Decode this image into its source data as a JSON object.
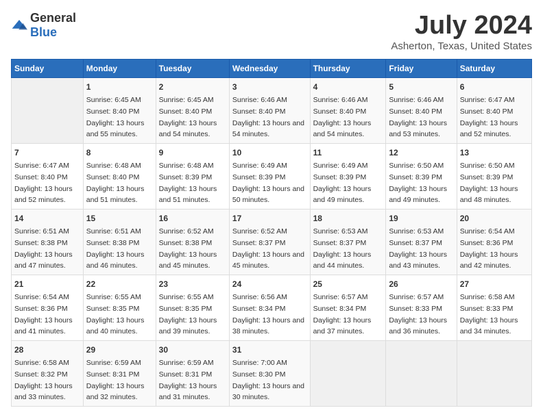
{
  "logo": {
    "general": "General",
    "blue": "Blue"
  },
  "title": {
    "month_year": "July 2024",
    "location": "Asherton, Texas, United States"
  },
  "days_of_week": [
    "Sunday",
    "Monday",
    "Tuesday",
    "Wednesday",
    "Thursday",
    "Friday",
    "Saturday"
  ],
  "weeks": [
    [
      {
        "day": "",
        "sunrise": "",
        "sunset": "",
        "daylight": ""
      },
      {
        "day": "1",
        "sunrise": "Sunrise: 6:45 AM",
        "sunset": "Sunset: 8:40 PM",
        "daylight": "Daylight: 13 hours and 55 minutes."
      },
      {
        "day": "2",
        "sunrise": "Sunrise: 6:45 AM",
        "sunset": "Sunset: 8:40 PM",
        "daylight": "Daylight: 13 hours and 54 minutes."
      },
      {
        "day": "3",
        "sunrise": "Sunrise: 6:46 AM",
        "sunset": "Sunset: 8:40 PM",
        "daylight": "Daylight: 13 hours and 54 minutes."
      },
      {
        "day": "4",
        "sunrise": "Sunrise: 6:46 AM",
        "sunset": "Sunset: 8:40 PM",
        "daylight": "Daylight: 13 hours and 54 minutes."
      },
      {
        "day": "5",
        "sunrise": "Sunrise: 6:46 AM",
        "sunset": "Sunset: 8:40 PM",
        "daylight": "Daylight: 13 hours and 53 minutes."
      },
      {
        "day": "6",
        "sunrise": "Sunrise: 6:47 AM",
        "sunset": "Sunset: 8:40 PM",
        "daylight": "Daylight: 13 hours and 52 minutes."
      }
    ],
    [
      {
        "day": "7",
        "sunrise": "Sunrise: 6:47 AM",
        "sunset": "Sunset: 8:40 PM",
        "daylight": "Daylight: 13 hours and 52 minutes."
      },
      {
        "day": "8",
        "sunrise": "Sunrise: 6:48 AM",
        "sunset": "Sunset: 8:40 PM",
        "daylight": "Daylight: 13 hours and 51 minutes."
      },
      {
        "day": "9",
        "sunrise": "Sunrise: 6:48 AM",
        "sunset": "Sunset: 8:39 PM",
        "daylight": "Daylight: 13 hours and 51 minutes."
      },
      {
        "day": "10",
        "sunrise": "Sunrise: 6:49 AM",
        "sunset": "Sunset: 8:39 PM",
        "daylight": "Daylight: 13 hours and 50 minutes."
      },
      {
        "day": "11",
        "sunrise": "Sunrise: 6:49 AM",
        "sunset": "Sunset: 8:39 PM",
        "daylight": "Daylight: 13 hours and 49 minutes."
      },
      {
        "day": "12",
        "sunrise": "Sunrise: 6:50 AM",
        "sunset": "Sunset: 8:39 PM",
        "daylight": "Daylight: 13 hours and 49 minutes."
      },
      {
        "day": "13",
        "sunrise": "Sunrise: 6:50 AM",
        "sunset": "Sunset: 8:39 PM",
        "daylight": "Daylight: 13 hours and 48 minutes."
      }
    ],
    [
      {
        "day": "14",
        "sunrise": "Sunrise: 6:51 AM",
        "sunset": "Sunset: 8:38 PM",
        "daylight": "Daylight: 13 hours and 47 minutes."
      },
      {
        "day": "15",
        "sunrise": "Sunrise: 6:51 AM",
        "sunset": "Sunset: 8:38 PM",
        "daylight": "Daylight: 13 hours and 46 minutes."
      },
      {
        "day": "16",
        "sunrise": "Sunrise: 6:52 AM",
        "sunset": "Sunset: 8:38 PM",
        "daylight": "Daylight: 13 hours and 45 minutes."
      },
      {
        "day": "17",
        "sunrise": "Sunrise: 6:52 AM",
        "sunset": "Sunset: 8:37 PM",
        "daylight": "Daylight: 13 hours and 45 minutes."
      },
      {
        "day": "18",
        "sunrise": "Sunrise: 6:53 AM",
        "sunset": "Sunset: 8:37 PM",
        "daylight": "Daylight: 13 hours and 44 minutes."
      },
      {
        "day": "19",
        "sunrise": "Sunrise: 6:53 AM",
        "sunset": "Sunset: 8:37 PM",
        "daylight": "Daylight: 13 hours and 43 minutes."
      },
      {
        "day": "20",
        "sunrise": "Sunrise: 6:54 AM",
        "sunset": "Sunset: 8:36 PM",
        "daylight": "Daylight: 13 hours and 42 minutes."
      }
    ],
    [
      {
        "day": "21",
        "sunrise": "Sunrise: 6:54 AM",
        "sunset": "Sunset: 8:36 PM",
        "daylight": "Daylight: 13 hours and 41 minutes."
      },
      {
        "day": "22",
        "sunrise": "Sunrise: 6:55 AM",
        "sunset": "Sunset: 8:35 PM",
        "daylight": "Daylight: 13 hours and 40 minutes."
      },
      {
        "day": "23",
        "sunrise": "Sunrise: 6:55 AM",
        "sunset": "Sunset: 8:35 PM",
        "daylight": "Daylight: 13 hours and 39 minutes."
      },
      {
        "day": "24",
        "sunrise": "Sunrise: 6:56 AM",
        "sunset": "Sunset: 8:34 PM",
        "daylight": "Daylight: 13 hours and 38 minutes."
      },
      {
        "day": "25",
        "sunrise": "Sunrise: 6:57 AM",
        "sunset": "Sunset: 8:34 PM",
        "daylight": "Daylight: 13 hours and 37 minutes."
      },
      {
        "day": "26",
        "sunrise": "Sunrise: 6:57 AM",
        "sunset": "Sunset: 8:33 PM",
        "daylight": "Daylight: 13 hours and 36 minutes."
      },
      {
        "day": "27",
        "sunrise": "Sunrise: 6:58 AM",
        "sunset": "Sunset: 8:33 PM",
        "daylight": "Daylight: 13 hours and 34 minutes."
      }
    ],
    [
      {
        "day": "28",
        "sunrise": "Sunrise: 6:58 AM",
        "sunset": "Sunset: 8:32 PM",
        "daylight": "Daylight: 13 hours and 33 minutes."
      },
      {
        "day": "29",
        "sunrise": "Sunrise: 6:59 AM",
        "sunset": "Sunset: 8:31 PM",
        "daylight": "Daylight: 13 hours and 32 minutes."
      },
      {
        "day": "30",
        "sunrise": "Sunrise: 6:59 AM",
        "sunset": "Sunset: 8:31 PM",
        "daylight": "Daylight: 13 hours and 31 minutes."
      },
      {
        "day": "31",
        "sunrise": "Sunrise: 7:00 AM",
        "sunset": "Sunset: 8:30 PM",
        "daylight": "Daylight: 13 hours and 30 minutes."
      },
      {
        "day": "",
        "sunrise": "",
        "sunset": "",
        "daylight": ""
      },
      {
        "day": "",
        "sunrise": "",
        "sunset": "",
        "daylight": ""
      },
      {
        "day": "",
        "sunrise": "",
        "sunset": "",
        "daylight": ""
      }
    ]
  ]
}
